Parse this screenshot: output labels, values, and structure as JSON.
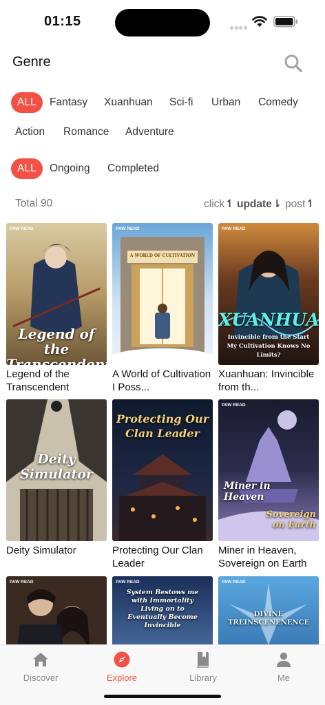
{
  "status": {
    "time": "01:15"
  },
  "header": {
    "title": "Genre"
  },
  "genres": [
    "ALL",
    "Fantasy",
    "Xuanhuan",
    "Sci-fi",
    "Urban",
    "Comedy",
    "Action",
    "Romance",
    "Adventure"
  ],
  "statuses": [
    "ALL",
    "Ongoing",
    "Completed"
  ],
  "results": {
    "total": "Total 90"
  },
  "sort": {
    "click": "click",
    "update": "update",
    "post": "post"
  },
  "books": [
    {
      "title": "Legend of the Transcendent",
      "cover_text": "Legend of the Transcendent",
      "badge": "PAW READ"
    },
    {
      "title": "A World of Cultivation I Poss...",
      "cover_text": "A WORLD OF CULTIVATION",
      "badge": "PAW READ"
    },
    {
      "title": "Xuanhuan: Invincible from th...",
      "cover_text": "XUANHUAN",
      "cover_sub": "Invincible from the Start My Cultivation Knows No Limits?",
      "badge": "PAW READ"
    },
    {
      "title": "Deity Simulator",
      "cover_text": "Deity Simulator",
      "badge": ""
    },
    {
      "title": "Protecting Our Clan Leader",
      "cover_text": "Protecting Our Clan Leader",
      "badge": ""
    },
    {
      "title": "Miner in Heaven, Sovereign on Earth",
      "cover_text": "Miner in Heaven",
      "cover_sub": "Sovereign on Earth",
      "badge": "PAW READ"
    },
    {
      "title": "",
      "cover_text": "",
      "badge": "PAW READ"
    },
    {
      "title": "",
      "cover_text": "System Bestows me with Immortality Living on to Eventually Become Invincible",
      "badge": "PAW READ"
    },
    {
      "title": "",
      "cover_text": "DIVINE TREINSCENENENCE",
      "badge": "PAW READ"
    }
  ],
  "tabs": [
    {
      "label": "Discover",
      "icon": "home-icon"
    },
    {
      "label": "Explore",
      "icon": "compass-icon"
    },
    {
      "label": "Library",
      "icon": "book-icon"
    },
    {
      "label": "Me",
      "icon": "person-icon"
    }
  ],
  "colors": {
    "accent": "#f35146",
    "text": "#222222",
    "muted": "#777777",
    "tab_inactive": "#8a8a8a"
  }
}
